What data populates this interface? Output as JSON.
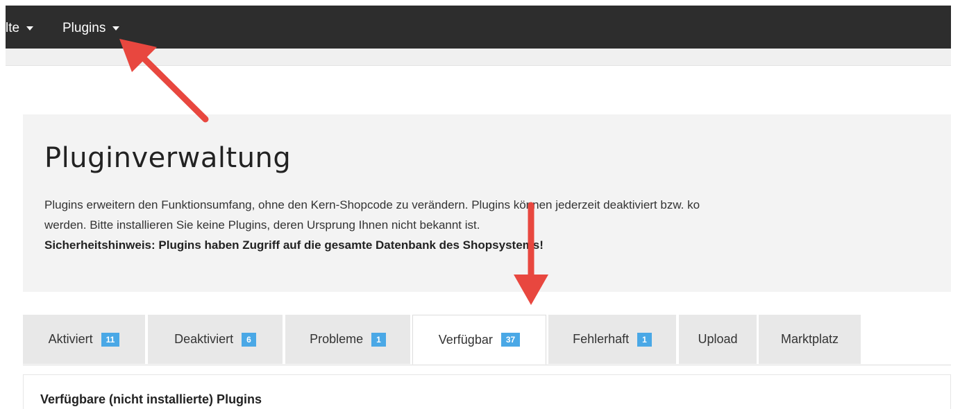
{
  "nav": {
    "items": [
      {
        "label": "lte"
      },
      {
        "label": "Plugins"
      }
    ]
  },
  "page": {
    "title": "Pluginverwaltung",
    "description_line1": "Plugins erweitern den Funktionsumfang, ohne den Kern-Shopcode zu verändern. Plugins können jederzeit deaktiviert bzw. ko",
    "description_line2": "werden. Bitte installieren Sie keine Plugins, deren Ursprung Ihnen nicht bekannt ist.",
    "warning": "Sicherheitshinweis: Plugins haben Zugriff auf die gesamte Datenbank des Shopsystems!"
  },
  "tabs": [
    {
      "label": "Aktiviert",
      "badge": "11"
    },
    {
      "label": "Deaktiviert",
      "badge": "6"
    },
    {
      "label": "Probleme",
      "badge": "1"
    },
    {
      "label": "Verfügbar",
      "badge": "37"
    },
    {
      "label": "Fehlerhaft",
      "badge": "1"
    },
    {
      "label": "Upload",
      "badge": ""
    },
    {
      "label": "Marktplatz",
      "badge": ""
    }
  ],
  "active_tab": "Verfügbar",
  "panel": {
    "heading": "Verfügbare (nicht installierte) Plugins"
  },
  "colors": {
    "navbar": "#2d2d2d",
    "badge": "#4aa8e6",
    "annotation_arrow": "#e8473f"
  }
}
